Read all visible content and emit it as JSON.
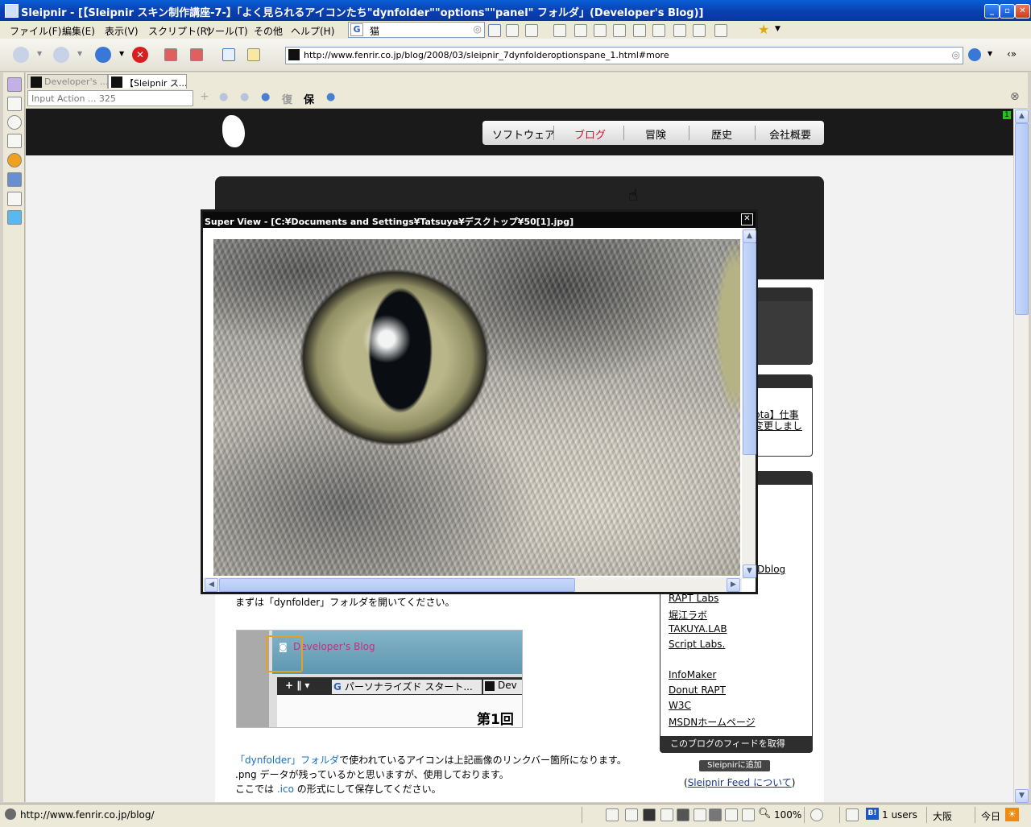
{
  "window": {
    "title": "Sleipnir - [【Sleipnir スキン制作講座-7-】「よく見られるアイコンたち\"dynfolder\"\"options\"\"panel\" フォルダ」(Developer's Blog)]"
  },
  "menu": {
    "items": [
      "ファイル(F)",
      "編集(E)",
      "表示(V)",
      "スクリプト(R)",
      "ツール(T)",
      "その他",
      "ヘルプ(H)"
    ],
    "search_value": "猫"
  },
  "address": {
    "url": "http://www.fenrir.co.jp/blog/2008/03/sleipnir_7dynfolderoptionspane_1.html#more"
  },
  "tabs": [
    {
      "label": "Developer's ..."
    },
    {
      "label": "【Sleipnir ス..."
    }
  ],
  "actionbar": {
    "placeholder": "Input Action ... 325",
    "restore_label": "復",
    "save_label": "保"
  },
  "site": {
    "nav": [
      "ソフトウェア",
      "ブログ",
      "冒険",
      "歴史",
      "会社概要"
    ],
    "nav_active_color": "#c8102e",
    "intro_text": "まずは「dynfolder」フォルダを開いてください。",
    "shot_tab": "Developer's Blog",
    "shot_tab2": "パーソナライズド スタート...",
    "shot_tab3": "Dev",
    "shot_heading": "第1回",
    "para1_link": "「dynfolder」フォルダ",
    "para1_rest": "で使われているアイコンは上記画像のリンクバー箇所になります。",
    "para2": ".png データが残っているかと思いますが、使用しております。",
    "para3_pre": "ここでは ",
    "para3_link": ".ico",
    "para3_post": " の形式にして保存してください。",
    "side_snip1": "pta】仕事",
    "side_snip2": "変更しまし",
    "side_snip3": "Dblog",
    "side_links": [
      "RAPT Labs",
      "堀江ラボ",
      "TAKUYA.LAB",
      "Script Labs."
    ],
    "side_links2": [
      "InfoMaker",
      "Donut RAPT",
      "W3C",
      "MSDNホームページ"
    ],
    "feed_label": "このブログのフィードを取得",
    "sleipnir_add": "Sleipnirに追加",
    "sleipnir_feed_link": "Sleipnir Feed について"
  },
  "superview": {
    "title": "Super View - [C:¥Documents and Settings¥Tatsuya¥デスクトップ¥50[1].jpg]"
  },
  "status": {
    "url": "http://www.fenrir.co.jp/blog/",
    "zoom": "100%",
    "users": "1 users",
    "city": "大阪",
    "today": "今日",
    "badge": "B!"
  }
}
